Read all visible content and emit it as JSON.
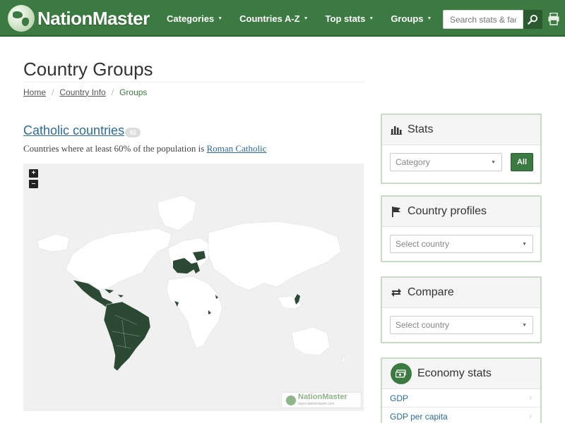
{
  "header": {
    "brand": "NationMaster",
    "nav": [
      {
        "label": "Categories"
      },
      {
        "label": "Countries A-Z"
      },
      {
        "label": "Top stats"
      },
      {
        "label": "Groups"
      }
    ],
    "search_placeholder": "Search stats & fact",
    "icons": {
      "search": "search-icon",
      "print": "print-icon",
      "caret": "caret-down-icon"
    }
  },
  "page": {
    "title": "Country Groups",
    "breadcrumb": [
      {
        "label": "Home"
      },
      {
        "label": "Country Info"
      },
      {
        "label": "Groups"
      }
    ]
  },
  "group": {
    "title": "Catholic countries",
    "count": "42",
    "description_prefix": "Countries where at least 60% of the population is ",
    "description_link": "Roman Catholic"
  },
  "map": {
    "zoom_in": "+",
    "zoom_out": "–",
    "watermark": "NationMaster",
    "watermark_url": "www.nationmaster.com",
    "land_color": "#ffffff",
    "highlight_color": "#2c4a33",
    "ocean_color": "#f0f0f0"
  },
  "sidebar": {
    "stats": {
      "title": "Stats",
      "select_placeholder": "Category",
      "button": "All",
      "icon": "bar-chart-icon"
    },
    "profiles": {
      "title": "Country profiles",
      "select_placeholder": "Select country",
      "icon": "flag-icon"
    },
    "compare": {
      "title": "Compare",
      "select_placeholder": "Select country",
      "icon": "swap-arrows-icon"
    },
    "economy": {
      "title": "Economy stats",
      "icon": "money-icon",
      "items": [
        {
          "label": "GDP"
        },
        {
          "label": "GDP per capita"
        }
      ]
    }
  },
  "colors": {
    "brand_green": "#3b7a40",
    "link_blue": "#2a6ca0",
    "panel_border": "#c8dcc5"
  }
}
